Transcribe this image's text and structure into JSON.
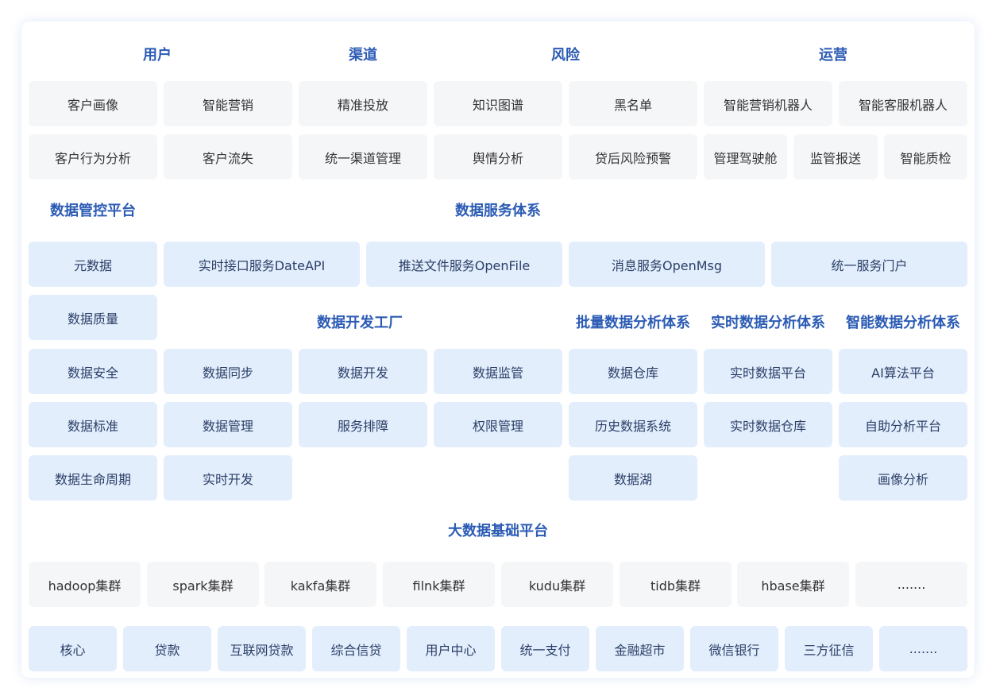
{
  "headers": {
    "user": "用户",
    "channel": "渠道",
    "risk": "风险",
    "ops": "运营",
    "governance": "数据管控平台",
    "service_system": "数据服务体系",
    "dev_factory": "数据开发工厂",
    "batch_analysis": "批量数据分析体系",
    "realtime_analysis": "实时数据分析体系",
    "smart_analysis": "智能数据分析体系",
    "bigdata_platform": "大数据基础平台"
  },
  "application_layer": {
    "row1": [
      "客户画像",
      "智能营销",
      "精准投放",
      "知识图谱",
      "黑名单",
      "智能营销机器人",
      "智能客服机器人"
    ],
    "row2": [
      "客户行为分析",
      "客户流失",
      "统一渠道管理",
      "舆情分析",
      "贷后风险预警",
      "管理驾驶舱",
      "监管报送",
      "智能质检"
    ]
  },
  "governance": [
    "元数据",
    "数据质量",
    "数据安全",
    "数据标准",
    "数据生命周期"
  ],
  "services": [
    "实时接口服务DateAPI",
    "推送文件服务OpenFile",
    "消息服务OpenMsg",
    "统一服务门户"
  ],
  "dev_factory": [
    "数据同步",
    "数据开发",
    "数据监管",
    "数据管理",
    "服务排障",
    "权限管理",
    "实时开发"
  ],
  "batch_analysis": [
    "数据仓库",
    "历史数据系统",
    "数据湖"
  ],
  "realtime_analysis": [
    "实时数据平台",
    "实时数据仓库"
  ],
  "smart_analysis": [
    "AI算法平台",
    "自助分析平台",
    "画像分析"
  ],
  "clusters": [
    "hadoop集群",
    "spark集群",
    "kakfa集群",
    "filnk集群",
    "kudu集群",
    "tidb集群",
    "hbase集群",
    "......."
  ],
  "source_systems": [
    "核心",
    "贷款",
    "互联网贷款",
    "综合信贷",
    "用户中心",
    "统一支付",
    "金融超市",
    "微信银行",
    "三方征信",
    "......."
  ]
}
